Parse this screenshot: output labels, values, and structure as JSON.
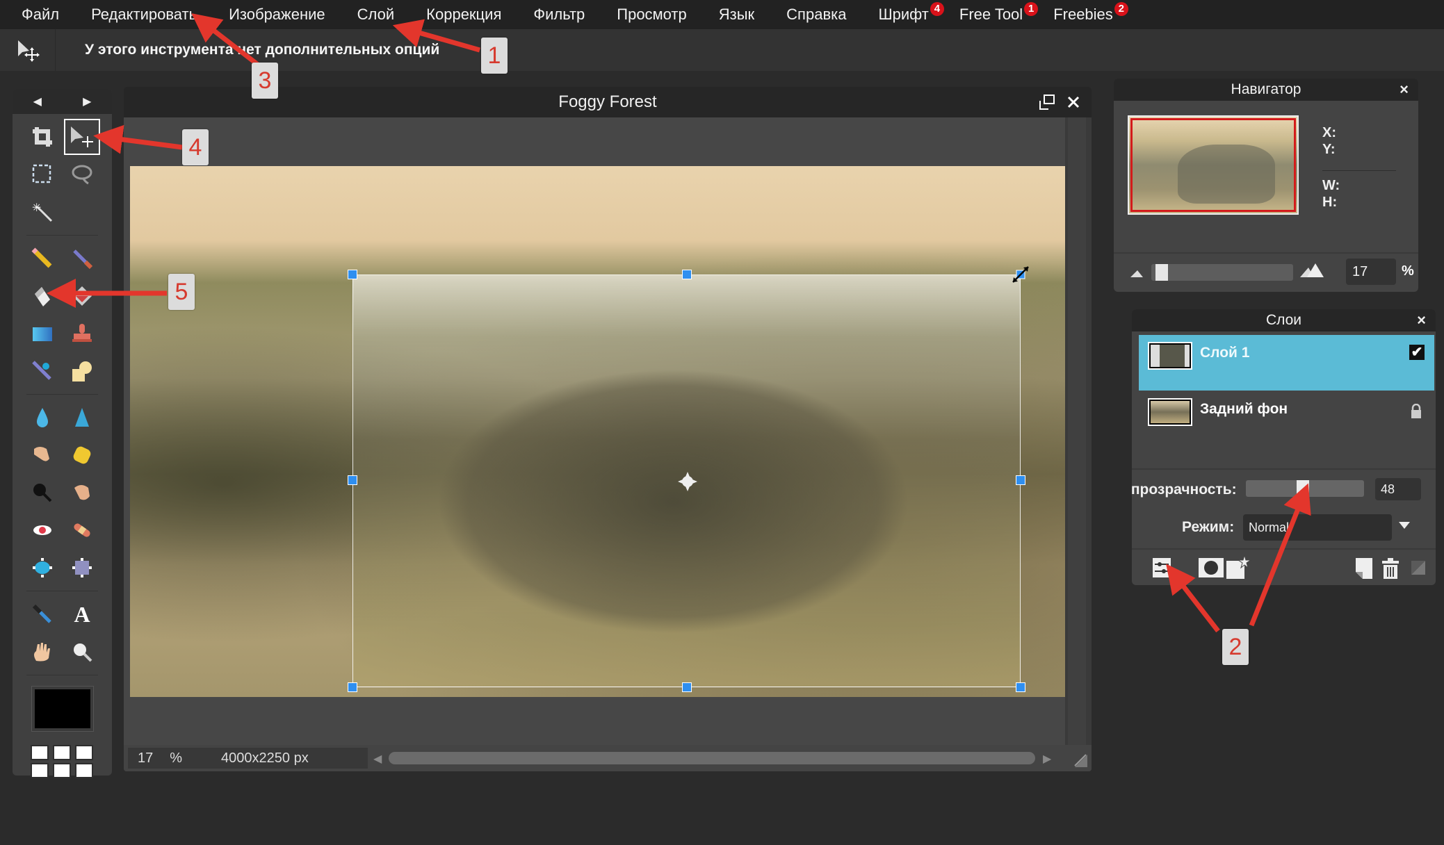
{
  "menu": {
    "items": [
      {
        "label": "Файл"
      },
      {
        "label": "Редактировать"
      },
      {
        "label": "Изображение"
      },
      {
        "label": "Слой"
      },
      {
        "label": "Коррекция"
      },
      {
        "label": "Фильтр"
      },
      {
        "label": "Просмотр"
      },
      {
        "label": "Язык"
      },
      {
        "label": "Справка"
      },
      {
        "label": "Шрифт",
        "badge": "4"
      },
      {
        "label": "Free Tool",
        "badge": "1"
      },
      {
        "label": "Freebies",
        "badge": "2"
      }
    ]
  },
  "options_bar": {
    "tool_icon": "move-tool-icon",
    "message": "У этого инструмента нет дополнительных опций"
  },
  "toolbox": {
    "nav_prev": "◀",
    "nav_next": "▶",
    "tools": [
      {
        "name": "crop",
        "icon": "crop-icon"
      },
      {
        "name": "move",
        "icon": "move-icon",
        "active": true
      },
      {
        "name": "marquee",
        "icon": "rect-select-icon"
      },
      {
        "name": "lasso",
        "icon": "lasso-icon"
      },
      {
        "name": "magic-wand",
        "icon": "magic-wand-icon"
      },
      {
        "name": "pencil",
        "icon": "pencil-icon"
      },
      {
        "name": "brush",
        "icon": "brush-icon"
      },
      {
        "name": "eraser",
        "icon": "eraser-icon"
      },
      {
        "name": "fill",
        "icon": "paint-bucket-icon"
      },
      {
        "name": "gradient",
        "icon": "gradient-icon"
      },
      {
        "name": "clone-stamp",
        "icon": "clone-stamp-icon"
      },
      {
        "name": "color-replace",
        "icon": "color-replace-icon"
      },
      {
        "name": "draw-shape",
        "icon": "shape-icon"
      },
      {
        "name": "blur",
        "icon": "blur-drop-icon"
      },
      {
        "name": "sharpen",
        "icon": "sharpen-icon"
      },
      {
        "name": "smudge",
        "icon": "smudge-finger-icon"
      },
      {
        "name": "sponge",
        "icon": "sponge-icon"
      },
      {
        "name": "dodge",
        "icon": "dodge-icon"
      },
      {
        "name": "burn",
        "icon": "burn-icon"
      },
      {
        "name": "red-eye",
        "icon": "red-eye-icon"
      },
      {
        "name": "spot-heal",
        "icon": "bandage-icon"
      },
      {
        "name": "bloat",
        "icon": "bloat-icon"
      },
      {
        "name": "pinch",
        "icon": "pinch-icon"
      },
      {
        "name": "color-picker",
        "icon": "eyedropper-icon"
      },
      {
        "name": "type",
        "icon": "type-icon",
        "glyph": "A"
      },
      {
        "name": "hand",
        "icon": "hand-icon"
      },
      {
        "name": "zoom",
        "icon": "zoom-icon"
      }
    ],
    "foreground_color": "#000000",
    "swatches": [
      "#ffffff",
      "#ffffff",
      "#ffffff",
      "#ffffff",
      "#ffffff",
      "#ffffff"
    ]
  },
  "document": {
    "title": "Foggy Forest",
    "zoom": "17",
    "zoom_unit": "%",
    "dimensions": "4000x2250 px"
  },
  "navigator": {
    "title": "Навигатор",
    "close": "×",
    "x_label": "X:",
    "y_label": "Y:",
    "w_label": "W:",
    "h_label": "H:",
    "zoom_value": "17",
    "zoom_unit": "%",
    "zoom_slider_fraction": 0.03
  },
  "layers": {
    "title": "Слои",
    "close": "×",
    "items": [
      {
        "name": "Слой 1",
        "selected": true,
        "visible": true,
        "visible_glyph": "✔"
      },
      {
        "name": "Задний фон",
        "selected": false,
        "locked": true
      }
    ],
    "opacity_label": "Непрозрачность:",
    "opacity_value": "48",
    "opacity_fraction": 0.48,
    "mode_label": "Режим:",
    "mode_value": "Normal",
    "accent": "#5bbbd6"
  },
  "annotations": [
    {
      "label": "1"
    },
    {
      "label": "2"
    },
    {
      "label": "3"
    },
    {
      "label": "4"
    },
    {
      "label": "5"
    }
  ],
  "colors": {
    "annotation_arrow": "#e3362c",
    "handle": "#2f8ff0",
    "badge": "#d9121a"
  }
}
